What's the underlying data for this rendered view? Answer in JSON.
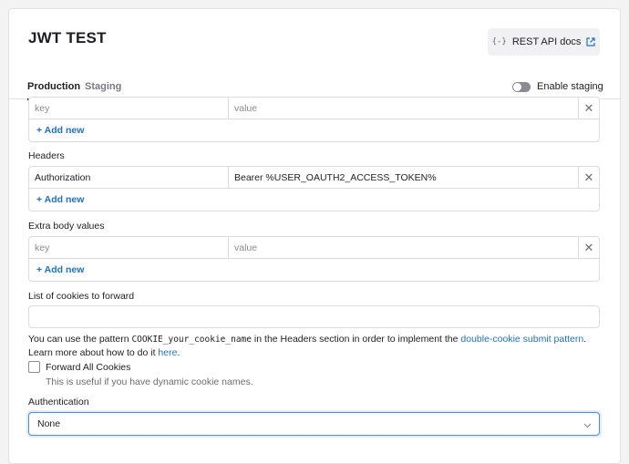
{
  "header": {
    "title": "JWT TEST",
    "docs_button": {
      "label": "REST API docs",
      "icon_left": "braces-icon",
      "icon_right": "external-link-icon"
    }
  },
  "tabs": [
    {
      "label": "Production",
      "active": true
    },
    {
      "label": "Staging",
      "active": false
    }
  ],
  "staging_toggle": {
    "label": "Enable staging",
    "enabled": false
  },
  "first_kv": {
    "rows": [
      {
        "key_placeholder": "key",
        "value_placeholder": "value"
      }
    ],
    "add_label": "+ Add new"
  },
  "headers": {
    "label": "Headers",
    "rows": [
      {
        "key": "Authorization",
        "value": "Bearer %USER_OAUTH2_ACCESS_TOKEN%"
      }
    ],
    "add_label": "+ Add new"
  },
  "extra_body": {
    "label": "Extra body values",
    "rows": [
      {
        "key_placeholder": "key",
        "value_placeholder": "value"
      }
    ],
    "add_label": "+ Add new"
  },
  "cookies": {
    "label": "List of cookies to forward",
    "value": "",
    "help_part1": "You can use the pattern ",
    "help_code": "COOKIE_your_cookie_name",
    "help_part2": " in the Headers section in order to implement the ",
    "help_link1": "double-cookie submit pattern",
    "help_part3": ". Learn more about how to do it ",
    "help_link2": "here",
    "help_part4": "."
  },
  "forward_all": {
    "label": "Forward All Cookies",
    "checked": false,
    "help": "This is useful if you have dynamic cookie names."
  },
  "authentication": {
    "label": "Authentication",
    "selected": "None"
  },
  "colors": {
    "accent": "#1f72c7",
    "focus": "#4b8fe0"
  }
}
